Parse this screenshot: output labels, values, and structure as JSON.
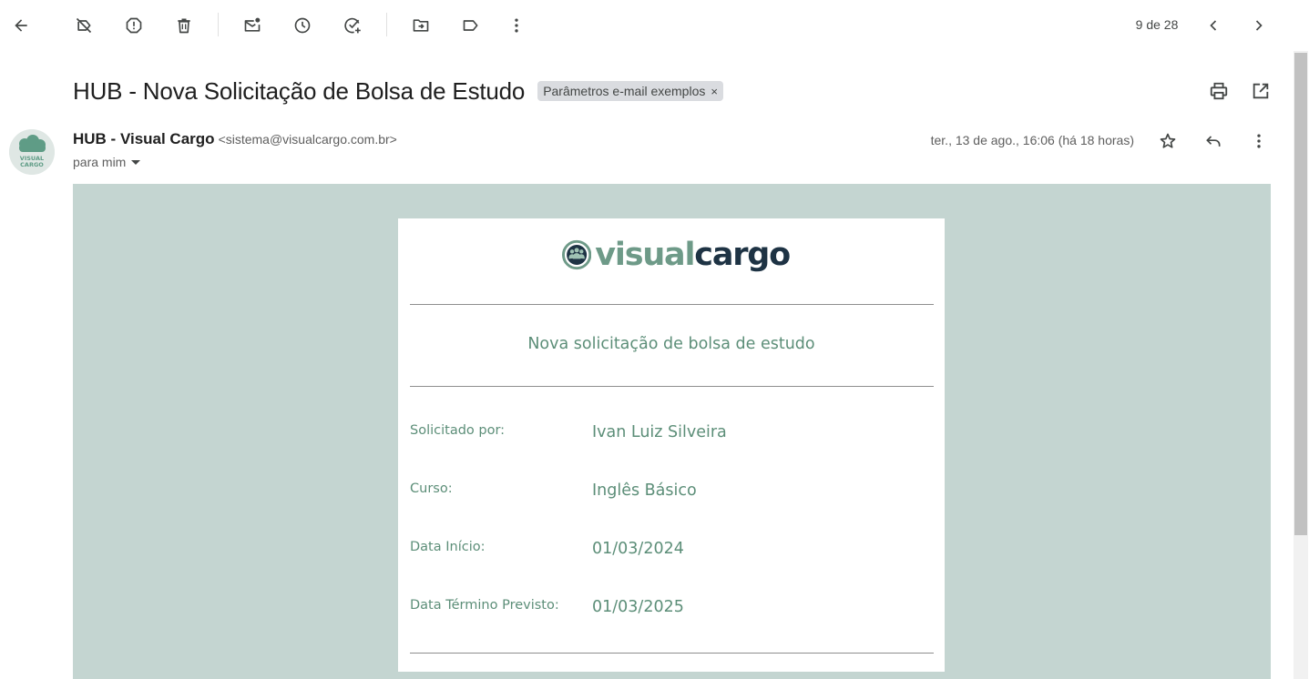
{
  "toolbar": {
    "pager": "9 de 28",
    "buttons": [
      "back-arrow-icon",
      "label-off-icon",
      "report-spam-icon",
      "delete-icon",
      "mark-unread-icon",
      "snooze-icon",
      "add-to-tasks-icon",
      "move-to-icon",
      "label-icon",
      "more-vert-icon"
    ]
  },
  "email": {
    "subject": "HUB - Nova Solicitação de Bolsa de Estudo",
    "label": "Parâmetros e-mail exemplos",
    "label_close": "×",
    "sender_name": "HUB - Visual Cargo",
    "sender_email": "<sistema@visualcargo.com.br>",
    "recipient": "para mim",
    "date": "ter., 13 de ago., 16:06 (há 18 horas)",
    "avatar_text": [
      "VISUAL",
      "CARGO"
    ]
  },
  "card": {
    "logo_part1": "visual",
    "logo_part2": "cargo",
    "title": "Nova solicitação de bolsa de estudo",
    "fields": [
      {
        "label": "Solicitado por:",
        "value": "Ivan Luiz Silveira"
      },
      {
        "label": "Curso:",
        "value": "Inglês Básico"
      },
      {
        "label": "Data Início:",
        "value": "01/03/2024"
      },
      {
        "label": "Data Término Previsto:",
        "value": "01/03/2025"
      }
    ]
  },
  "colors": {
    "body_bg": "#c4d5d1",
    "accent_green": "#5c8e78",
    "logo_dark": "#1e3344"
  }
}
